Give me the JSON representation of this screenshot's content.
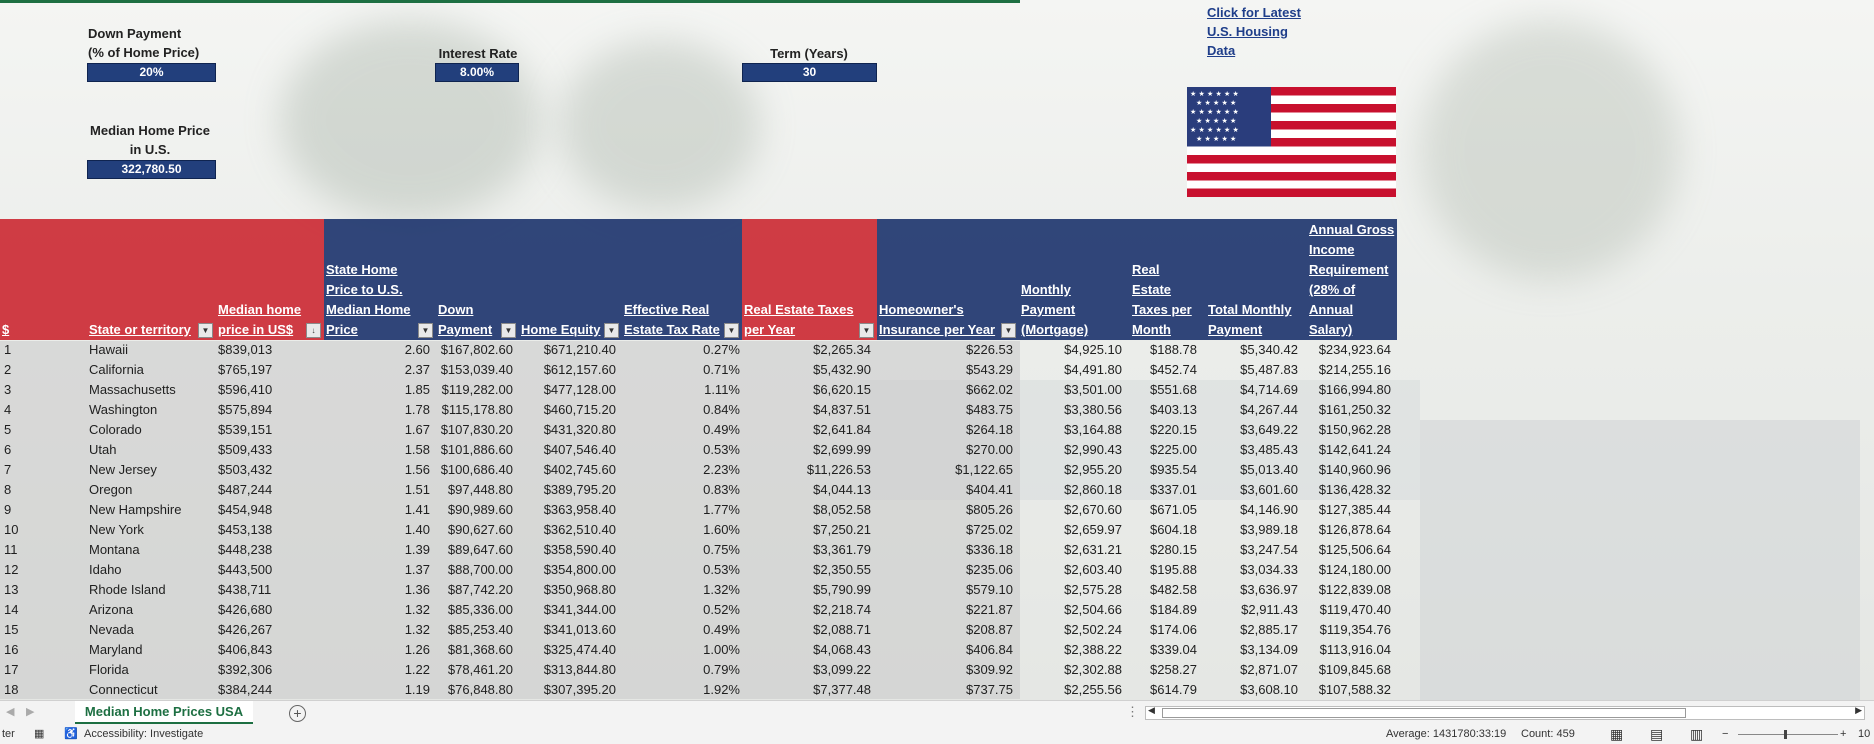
{
  "inputs": {
    "down_payment_label": "Down Payment\n(% of Home Price)",
    "down_payment_value": "20%",
    "interest_label": "Interest Rate",
    "interest_value": "8.00%",
    "term_label": "Term (Years)",
    "term_value": "30",
    "median_label": "Median Home Price\nin U.S.",
    "median_value": "322,780.50"
  },
  "link": {
    "text": "Click for Latest\nU.S. Housing\nData"
  },
  "headers": {
    "idx": "$",
    "state": "State or territory",
    "median": "Median home\nprice in US$",
    "ratio": "State Home\nPrice to U.S.\nMedian Home\nPrice",
    "down": "Down\nPayment",
    "equity": "Home Equity",
    "taxrate": "Effective Real\nEstate Tax Rate",
    "taxes": "Real Estate Taxes\nper Year",
    "insurance": "Homeowner's\nInsurance per Year",
    "monthly": "Monthly\nPayment\n(Mortgage)",
    "taxmonth": "Real\nEstate\nTaxes per\nMonth",
    "total": "Total Monthly\nPayment",
    "income": "Annual Gross\nIncome\nRequirement\n(28% of\nAnnual\nSalary)"
  },
  "rows": [
    [
      "1",
      "Hawaii",
      "$839,013",
      "2.60",
      "$167,802.60",
      "$671,210.40",
      "0.27%",
      "$2,265.34",
      "$226.53",
      "$4,925.10",
      "$188.78",
      "$5,340.42",
      "$234,923.64"
    ],
    [
      "2",
      "California",
      "$765,197",
      "2.37",
      "$153,039.40",
      "$612,157.60",
      "0.71%",
      "$5,432.90",
      "$543.29",
      "$4,491.80",
      "$452.74",
      "$5,487.83",
      "$214,255.16"
    ],
    [
      "3",
      "Massachusetts",
      "$596,410",
      "1.85",
      "$119,282.00",
      "$477,128.00",
      "1.11%",
      "$6,620.15",
      "$662.02",
      "$3,501.00",
      "$551.68",
      "$4,714.69",
      "$166,994.80"
    ],
    [
      "4",
      "Washington",
      "$575,894",
      "1.78",
      "$115,178.80",
      "$460,715.20",
      "0.84%",
      "$4,837.51",
      "$483.75",
      "$3,380.56",
      "$403.13",
      "$4,267.44",
      "$161,250.32"
    ],
    [
      "5",
      "Colorado",
      "$539,151",
      "1.67",
      "$107,830.20",
      "$431,320.80",
      "0.49%",
      "$2,641.84",
      "$264.18",
      "$3,164.88",
      "$220.15",
      "$3,649.22",
      "$150,962.28"
    ],
    [
      "6",
      "Utah",
      "$509,433",
      "1.58",
      "$101,886.60",
      "$407,546.40",
      "0.53%",
      "$2,699.99",
      "$270.00",
      "$2,990.43",
      "$225.00",
      "$3,485.43",
      "$142,641.24"
    ],
    [
      "7",
      "New Jersey",
      "$503,432",
      "1.56",
      "$100,686.40",
      "$402,745.60",
      "2.23%",
      "$11,226.53",
      "$1,122.65",
      "$2,955.20",
      "$935.54",
      "$5,013.40",
      "$140,960.96"
    ],
    [
      "8",
      "Oregon",
      "$487,244",
      "1.51",
      "$97,448.80",
      "$389,795.20",
      "0.83%",
      "$4,044.13",
      "$404.41",
      "$2,860.18",
      "$337.01",
      "$3,601.60",
      "$136,428.32"
    ],
    [
      "9",
      "New Hampshire",
      "$454,948",
      "1.41",
      "$90,989.60",
      "$363,958.40",
      "1.77%",
      "$8,052.58",
      "$805.26",
      "$2,670.60",
      "$671.05",
      "$4,146.90",
      "$127,385.44"
    ],
    [
      "10",
      "New York",
      "$453,138",
      "1.40",
      "$90,627.60",
      "$362,510.40",
      "1.60%",
      "$7,250.21",
      "$725.02",
      "$2,659.97",
      "$604.18",
      "$3,989.18",
      "$126,878.64"
    ],
    [
      "11",
      "Montana",
      "$448,238",
      "1.39",
      "$89,647.60",
      "$358,590.40",
      "0.75%",
      "$3,361.79",
      "$336.18",
      "$2,631.21",
      "$280.15",
      "$3,247.54",
      "$125,506.64"
    ],
    [
      "12",
      "Idaho",
      "$443,500",
      "1.37",
      "$88,700.00",
      "$354,800.00",
      "0.53%",
      "$2,350.55",
      "$235.06",
      "$2,603.40",
      "$195.88",
      "$3,034.33",
      "$124,180.00"
    ],
    [
      "13",
      "Rhode Island",
      "$438,711",
      "1.36",
      "$87,742.20",
      "$350,968.80",
      "1.32%",
      "$5,790.99",
      "$579.10",
      "$2,575.28",
      "$482.58",
      "$3,636.97",
      "$122,839.08"
    ],
    [
      "14",
      "Arizona",
      "$426,680",
      "1.32",
      "$85,336.00",
      "$341,344.00",
      "0.52%",
      "$2,218.74",
      "$221.87",
      "$2,504.66",
      "$184.89",
      "$2,911.43",
      "$119,470.40"
    ],
    [
      "15",
      "Nevada",
      "$426,267",
      "1.32",
      "$85,253.40",
      "$341,013.60",
      "0.49%",
      "$2,088.71",
      "$208.87",
      "$2,502.24",
      "$174.06",
      "$2,885.17",
      "$119,354.76"
    ],
    [
      "16",
      "Maryland",
      "$406,843",
      "1.26",
      "$81,368.60",
      "$325,474.40",
      "1.00%",
      "$4,068.43",
      "$406.84",
      "$2,388.22",
      "$339.04",
      "$3,134.09",
      "$113,916.04"
    ],
    [
      "17",
      "Florida",
      "$392,306",
      "1.22",
      "$78,461.20",
      "$313,844.80",
      "0.79%",
      "$3,099.22",
      "$309.92",
      "$2,302.88",
      "$258.27",
      "$2,871.07",
      "$109,845.68"
    ],
    [
      "18",
      "Connecticut",
      "$384,244",
      "1.19",
      "$76,848.80",
      "$307,395.20",
      "1.92%",
      "$7,377.48",
      "$737.75",
      "$2,255.56",
      "$614.79",
      "$3,608.10",
      "$107,588.32"
    ]
  ],
  "sheet_tab": "Median Home Prices USA",
  "status": {
    "left_cut": "ter",
    "accessibility": "Accessibility: Investigate",
    "average": "Average: 1431780:33:19",
    "count": "Count: 459",
    "zoom": "10"
  },
  "colors": {
    "red_header": "#c8141e",
    "blue_header": "#162d69",
    "accent": "#1d6f42"
  }
}
